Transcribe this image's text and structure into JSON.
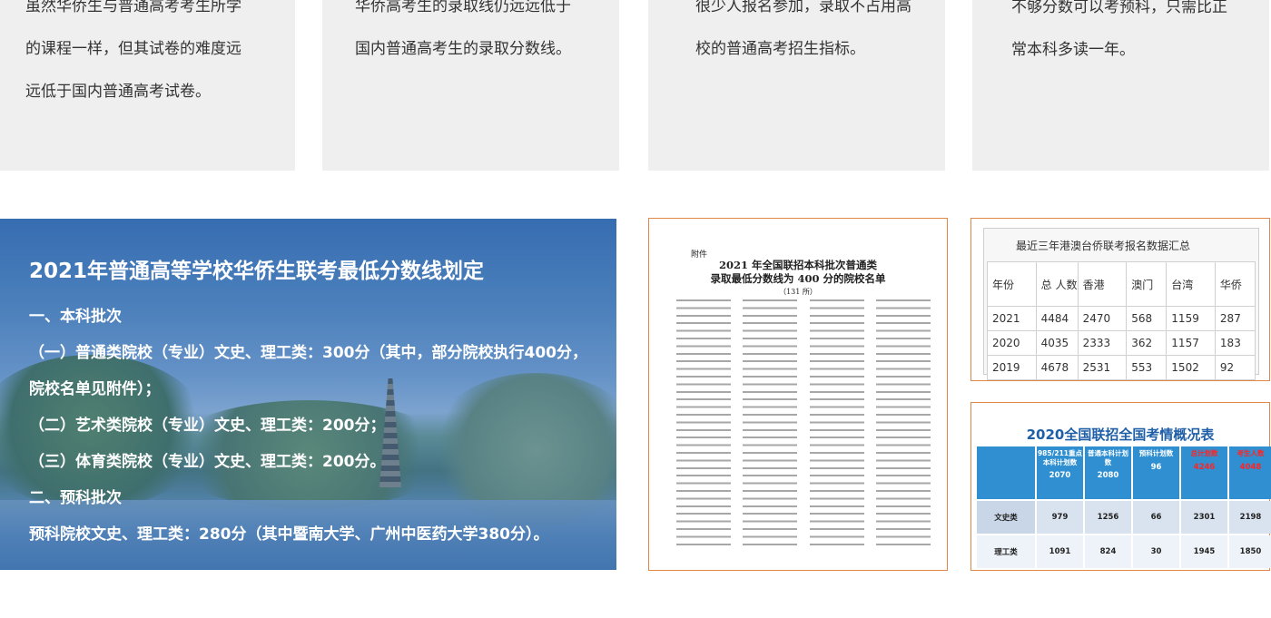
{
  "cards": [
    {
      "lines": [
        "虽然华侨生与普通高考考生所学",
        "的课程一样，但其试卷的难度远",
        "远低于国内普通高考试卷。"
      ]
    },
    {
      "lines": [
        "华侨高考生的录取线仍远远低于",
        "国内普通高考生的录取分数线。"
      ]
    },
    {
      "lines": [
        "很少人报名参加，录取不占用高",
        "校的普通高考招生指标。"
      ]
    },
    {
      "lines": [
        "不够分数可以考预科，只需比正",
        "常本科多读一年。"
      ]
    }
  ],
  "hero": {
    "title": "2021年普通高等学校华侨生联考最低分数线划定",
    "lines": [
      "一、本科批次",
      "（一）普通类院校（专业）文史、理工类：300分（其中，部分院校执行400分，",
      "院校名单见附件）；",
      "（二）艺术类院校（专业）文史、理工类：200分；",
      "（三）体育类院校（专业）文史、理工类：200分。",
      "二、预科批次",
      "预科院校文史、理工类：280分（其中暨南大学、广州中医药大学380分）。"
    ]
  },
  "doc": {
    "attachment": "附件",
    "title_line1": "2021 年全国联招本科批次普通类",
    "title_line2": "录取最低分数线为 400 分的院校名单",
    "count": "（131 所）"
  },
  "stats": {
    "caption": "最近三年港澳台侨联考报名数据汇总",
    "headers": [
      "年份",
      "总  人数",
      "香港",
      "澳门",
      "台湾",
      "华侨"
    ],
    "rows": [
      [
        "2021",
        "4484",
        "2470",
        "568",
        "1159",
        "287"
      ],
      [
        "2020",
        "4035",
        "2333",
        "362",
        "1157",
        "183"
      ],
      [
        "2019",
        "4678",
        "2531",
        "553",
        "1502",
        "92"
      ]
    ]
  },
  "situation": {
    "title": "2020全国联招全国考情概况表",
    "headers": [
      {
        "label": "985/211重点本科计划数",
        "value": "2070",
        "red": false
      },
      {
        "label": "普通本科计划数",
        "value": "2080",
        "red": false
      },
      {
        "label": "预科计划数",
        "value": "96",
        "red": false
      },
      {
        "label": "总计划数",
        "value": "4246",
        "red": true
      },
      {
        "label": "考生人数",
        "value": "4048",
        "red": true
      }
    ],
    "rows": [
      {
        "label": "文史类",
        "values": [
          "979",
          "1256",
          "66",
          "2301",
          "2198"
        ]
      },
      {
        "label": "理工类",
        "values": [
          "1091",
          "824",
          "30",
          "1945",
          "1850"
        ]
      }
    ]
  }
}
